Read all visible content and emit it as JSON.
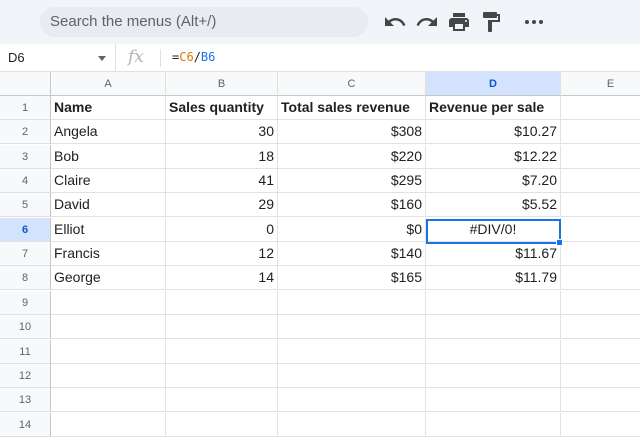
{
  "toolbar": {
    "search_placeholder": "Search the menus (Alt+/)",
    "icons": [
      "undo-icon",
      "redo-icon",
      "print-icon",
      "paint-format-icon",
      "more-icon"
    ]
  },
  "formula_bar": {
    "name_box": "D6",
    "fx_label": "fx",
    "formula_prefix": "=",
    "formula_ref1": "C6",
    "formula_sep": "/",
    "formula_ref2": "B6"
  },
  "columns": [
    "A",
    "B",
    "C",
    "D",
    "E"
  ],
  "rows": [
    "1",
    "2",
    "3",
    "4",
    "5",
    "6",
    "7",
    "8",
    "9",
    "10",
    "11",
    "12",
    "13",
    "14"
  ],
  "table": {
    "headers": [
      "Name",
      "Sales quantity",
      "Total sales revenue",
      "Revenue per sale"
    ],
    "data": [
      [
        "Angela",
        "30",
        "$308",
        "$10.27"
      ],
      [
        "Bob",
        "18",
        "$220",
        "$12.22"
      ],
      [
        "Claire",
        "41",
        "$295",
        "$7.20"
      ],
      [
        "David",
        "29",
        "$160",
        "$5.52"
      ],
      [
        "Elliot",
        "0",
        "$0",
        "#DIV/0!"
      ],
      [
        "Francis",
        "12",
        "$140",
        "$11.67"
      ],
      [
        "George",
        "14",
        "$165",
        "$11.79"
      ]
    ]
  },
  "selection": {
    "cell": "D6",
    "column": "D",
    "row": "6"
  },
  "colors": {
    "selection": "#1a73e8",
    "header_selected_bg": "#d3e3fd",
    "toolbar_bg": "#f1f4f9"
  }
}
